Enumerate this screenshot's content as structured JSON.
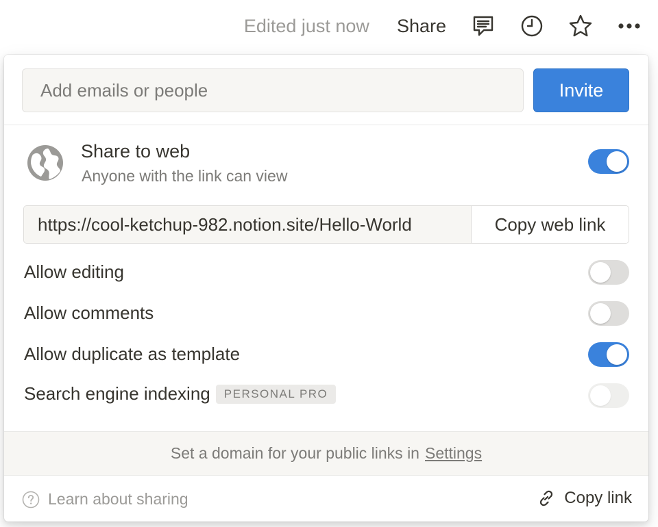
{
  "topbar": {
    "edited": "Edited just now",
    "share_label": "Share",
    "icons": [
      "comment-icon",
      "clock-icon",
      "star-icon",
      "more-icon"
    ]
  },
  "invite": {
    "placeholder": "Add emails or people",
    "button_label": "Invite"
  },
  "web": {
    "title": "Share to web",
    "subtitle": "Anyone with the link can view",
    "enabled": true,
    "url": "https://cool-ketchup-982.notion.site/Hello-World",
    "copy_label": "Copy web link"
  },
  "options": [
    {
      "label": "Allow editing",
      "state": "off"
    },
    {
      "label": "Allow comments",
      "state": "off"
    },
    {
      "label": "Allow duplicate as template",
      "state": "on"
    },
    {
      "label": "Search engine indexing",
      "badge": "PERSONAL PRO",
      "state": "disabled"
    }
  ],
  "domain": {
    "text": "Set a domain for your public links in",
    "link": "Settings"
  },
  "footer": {
    "learn": "Learn about sharing",
    "copy_link": "Copy link"
  },
  "colors": {
    "accent": "#3a82dc",
    "text": "#37352f",
    "muted": "#7c7b78"
  }
}
